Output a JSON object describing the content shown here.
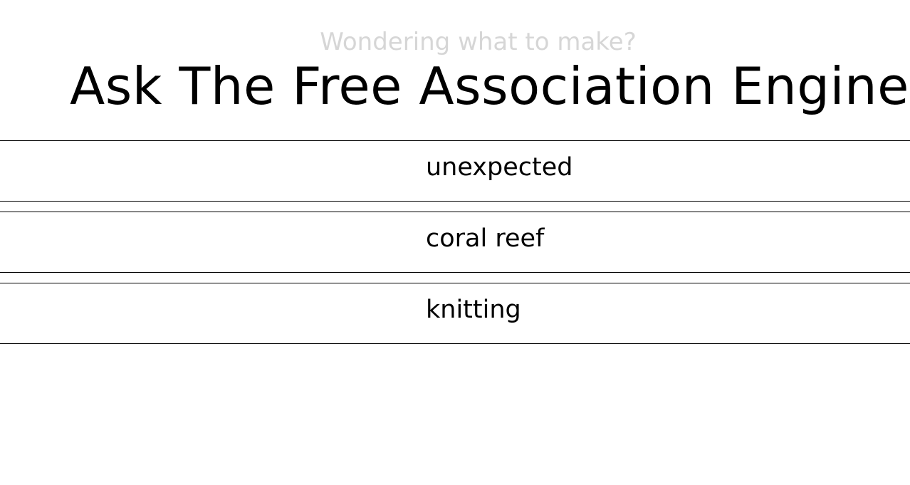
{
  "header": {
    "subtitle": "Wondering what to make?",
    "title": "Ask The Free Association Engine"
  },
  "words": [
    {
      "label": "unexpected"
    },
    {
      "label": "coral reef"
    },
    {
      "label": "knitting"
    }
  ]
}
